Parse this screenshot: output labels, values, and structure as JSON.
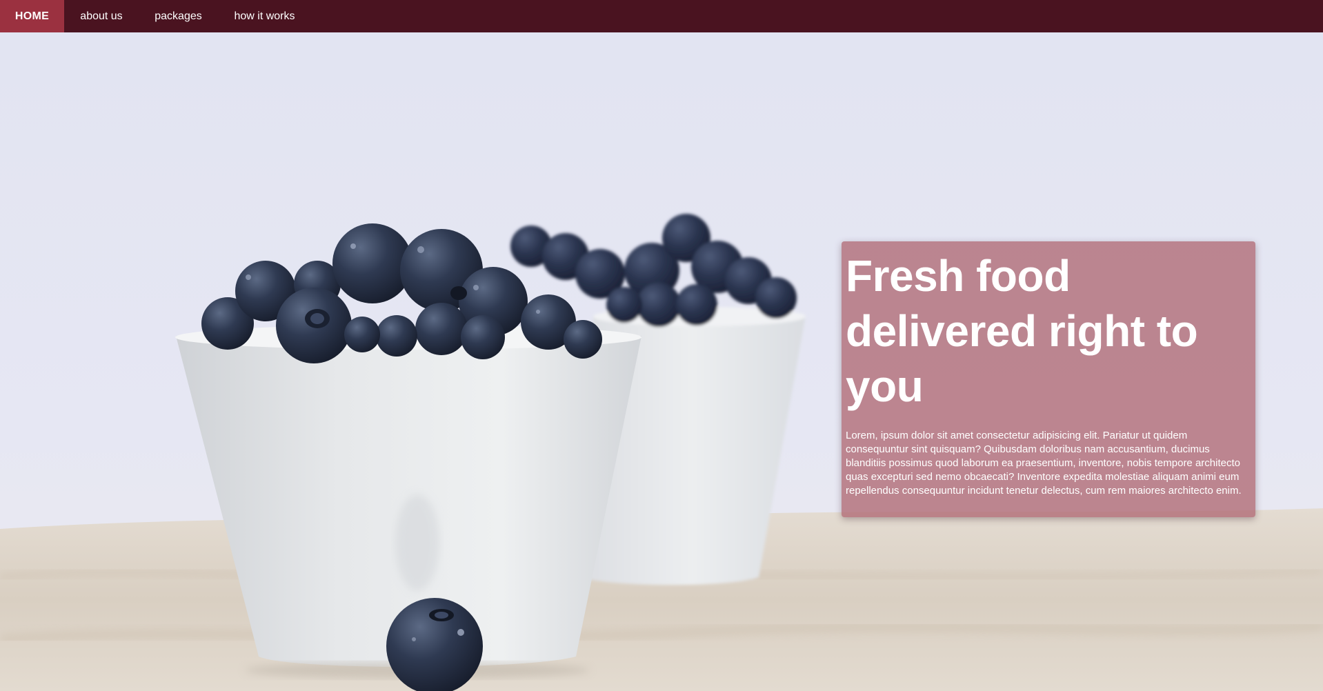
{
  "nav": {
    "items": [
      {
        "label": "HOME",
        "active": true
      },
      {
        "label": "about us",
        "active": false
      },
      {
        "label": "packages",
        "active": false
      },
      {
        "label": "how it works",
        "active": false
      }
    ]
  },
  "hero": {
    "title": "Fresh food delivered right to you",
    "body": "Lorem, ipsum dolor sit amet consectetur adipisicing elit. Pariatur ut quidem consequuntur sint quisquam? Quibusdam doloribus nam accusantium, ducimus blanditiis possimus quod laborum ea praesentium, inventore, nobis tempore architecto quas excepturi sed nemo obcaecati? Inventore expedita molestiae aliquam animi eum repellendus consequuntur incidunt tenetur delectus, cum rem maiores architecto enim."
  },
  "colors": {
    "navbar": "#4a1320",
    "nav_active": "#9b3140",
    "card": "#b0696f",
    "text": "#ffffff"
  }
}
